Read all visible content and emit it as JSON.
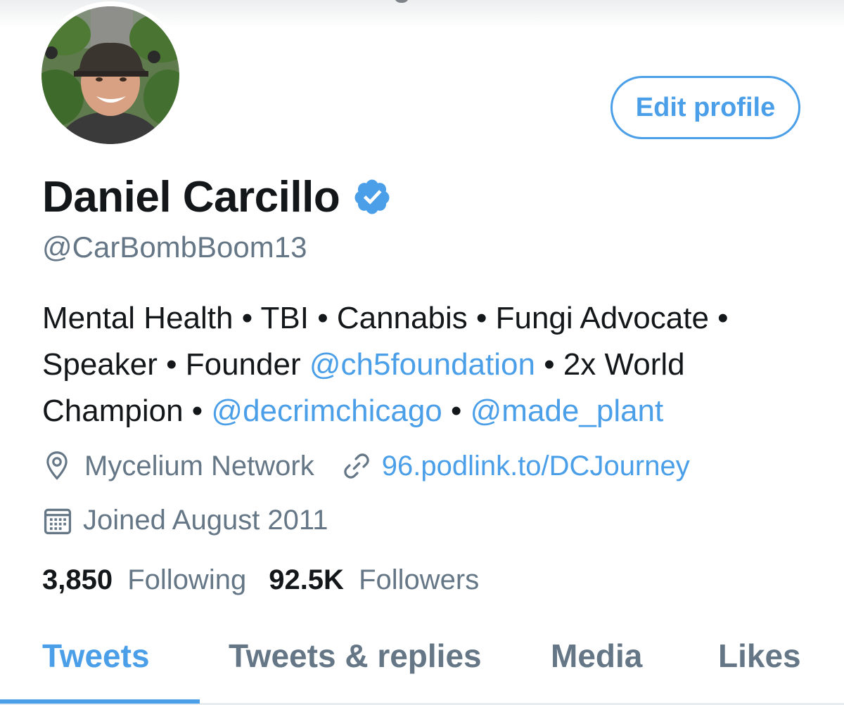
{
  "profile": {
    "name": "Daniel Carcillo",
    "handle": "@CarBombBoom13",
    "verified": true,
    "avatar_icon": "profile-photo"
  },
  "actions": {
    "edit_profile_label": "Edit profile"
  },
  "bio": {
    "segments": [
      {
        "text": "Mental Health • TBI • Cannabis • Fungi Advocate • Speaker • Founder ",
        "link": false
      },
      {
        "text": "@ch5foundation",
        "link": true
      },
      {
        "text": " • 2x World Champion • ",
        "link": false
      },
      {
        "text": "@decrimchicago",
        "link": true
      },
      {
        "text": " • ",
        "link": false
      },
      {
        "text": "@made_plant",
        "link": true
      }
    ]
  },
  "meta": {
    "location": "Mycelium Network",
    "location_icon": "location-pin-icon",
    "website": "96.podlink.to/DCJourney",
    "website_icon": "link-icon",
    "joined": "Joined August 2011",
    "joined_icon": "calendar-icon"
  },
  "stats": {
    "following_count": "3,850",
    "following_label": "Following",
    "followers_count": "92.5K",
    "followers_label": "Followers"
  },
  "tabs": [
    {
      "label": "Tweets",
      "active": true
    },
    {
      "label": "Tweets & replies",
      "active": false
    },
    {
      "label": "Media",
      "active": false
    },
    {
      "label": "Likes",
      "active": false
    }
  ],
  "colors": {
    "accent": "#4a9fe8",
    "text_primary": "#14171a",
    "text_secondary": "#657786"
  }
}
